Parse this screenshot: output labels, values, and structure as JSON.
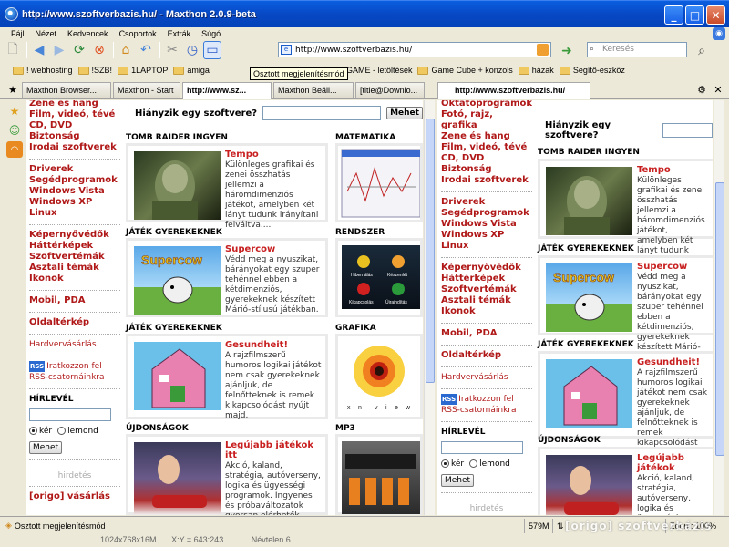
{
  "window": {
    "title": "http://www.szoftverbazis.hu/ - Maxthon 2.0.9-beta"
  },
  "menu": [
    "Fájl",
    "Nézet",
    "Kedvencek",
    "Csoportok",
    "Extrák",
    "Súgó"
  ],
  "address": {
    "url": "http://www.szoftverbazis.hu/"
  },
  "search": {
    "placeholder": "Keresés"
  },
  "favorites": [
    "! webhosting",
    "!SZB!",
    "1LAPTOP",
    "amiga",
    "emuk",
    "GAME - letöltések",
    "Game Cube + konzols",
    "házak",
    "Segítő-eszköz"
  ],
  "tooltip": "Osztott megjelenítésmód",
  "tabs": [
    "Maxthon Browser...",
    "Maxthon - Start",
    "http://www.sz...",
    "Maxthon Beáll...",
    "[title@Downlo...",
    "http://www.szoftverbazis.hu/"
  ],
  "left": {
    "nav_top": [
      "Zene és hang",
      "Film, videó, tévé",
      "CD, DVD",
      "Biztonság",
      "Irodai szoftverek"
    ],
    "nav_sys": [
      "Driverek",
      "Segédprogramok",
      "Windows Vista",
      "Windows XP",
      "Linux"
    ],
    "nav_desk": [
      "Képernyővédők",
      "Háttérképek",
      "Szoftvertémák",
      "Asztali témák",
      "Ikonok"
    ],
    "mobile": "Mobil, PDA",
    "sitemap": "Oldaltérkép",
    "hardware": "Hardvervásárlás",
    "rss_badge": "RSS",
    "rss": "Iratkozzon fel RSS-csatornáinkra",
    "newsletter": "HÍRLEVÉL",
    "radio_yes": "kér",
    "radio_no": "lemond",
    "submit": "Mehet",
    "ad": "hirdetés",
    "origo": "[origo] vásárlás",
    "missing_label": "Hiányzik egy szoftvere?",
    "missing_btn": "Mehet",
    "sections": [
      "TOMB RAIDER INGYEN",
      "JÁTÉK GYEREKEKNEK",
      "JÁTÉK GYEREKEKNEK",
      "ÚJDONSÁGOK"
    ],
    "side_sections": [
      "MATEMATIKA",
      "RENDSZER",
      "GRAFIKA",
      "MP3"
    ],
    "cards": [
      {
        "title": "Tempo",
        "text": "Különleges grafikai és zenei összhatás jellemzi a háromdimenziós játékot, amelyben két lányt tudunk irányítani felváltva...."
      },
      {
        "title": "Supercow",
        "text": "Védd meg a nyuszikat, bárányokat egy szuper tehénnel ebben a kétdimenziós, gyerekeknek készített Márió-stílusú játékban."
      },
      {
        "title": "Gesundheit!",
        "text": "A rajzfilmszerű humoros logikai játékot nem csak gyerekeknek ajánljuk, de felnőtteknek is remek kikapcsolódást nyújt majd."
      },
      {
        "title": "Legújabb játékok itt",
        "text": "Akció, kaland, stratégia, autóverseny, logika és ügyességi programok. Ingyenes és próbaváltozatok gyorsan elérhetők."
      }
    ],
    "rendszer_labels": [
      "Hibernálás",
      "Készenlét",
      "Kikapcsolás",
      "Újraindítás"
    ],
    "supercow_logo": "Supercow",
    "xnview_letters": [
      "x",
      "n",
      "v",
      "i",
      "e",
      "w"
    ]
  },
  "right": {
    "nav_top": [
      "Oktatóprogramok",
      "Fotó, rajz, grafika",
      "Zene és hang",
      "Film, videó, tévé",
      "CD, DVD",
      "Biztonság",
      "Irodai szoftverek"
    ],
    "nav_sys": [
      "Driverek",
      "Segédprogramok",
      "Windows Vista",
      "Windows XP",
      "Linux"
    ],
    "nav_desk": [
      "Képernyővédők",
      "Háttérképek",
      "Szoftvertémák",
      "Asztali témák",
      "Ikonok"
    ],
    "mobile": "Mobil, PDA",
    "sitemap": "Oldaltérkép",
    "hardware": "Hardvervásárlás",
    "rss_badge": "RSS",
    "rss": "Iratkozzon fel RSS-csatornáinkra",
    "newsletter": "HÍRLEVÉL",
    "radio_yes": "kér",
    "radio_no": "lemond",
    "submit": "Mehet",
    "ad": "hirdetés",
    "missing_label": "Hiányzik egy szoftvere?",
    "sections": [
      "TOMB RAIDER INGYEN",
      "JÁTÉK GYEREKEKNEK",
      "JÁTÉK GYEREKEKNEK",
      "ÚJDONSÁGOK"
    ],
    "cards": [
      {
        "title": "Tempo",
        "text": "Különleges grafikai és zenei összhatás jellemzi a háromdimenziós játékot, amelyben két lányt tudunk irányítani felváltva...."
      },
      {
        "title": "Supercow",
        "text": "Védd meg a nyuszikat, bárányokat egy szuper tehénnel ebben a kétdimenziós, gyerekeknek készített Márió-stílusú játékban."
      },
      {
        "title": "Gesundheit!",
        "text": "A rajzfilmszerű humoros logikai játékot nem csak gyerekeknek ajánljuk, de felnőtteknek is remek kikapcsolódást nyújt majd."
      },
      {
        "title": "Legújabb játékok",
        "text": "Akció, kaland, stratégia, autóverseny, logika és ügyességi programok. Ingyenes és próbaváltozatok"
      }
    ],
    "supercow_logo": "Supercow"
  },
  "status": {
    "text": "Osztott megjelenítésmód",
    "mem": "579M",
    "zoom": "Zoom: 100%"
  },
  "taskhint": {
    "res": "1024x768x16M",
    "xy": "X:Y = 643:243",
    "level": "Névtelen 6"
  },
  "watermark": "[origo] szoftverbázis",
  "colors": {
    "link": "#b01818",
    "title_bar": "#0848c4"
  }
}
